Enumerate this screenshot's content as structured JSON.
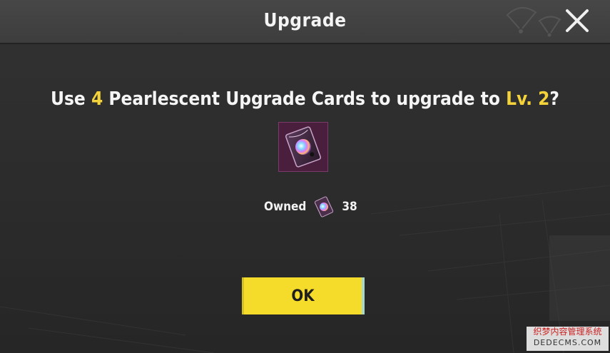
{
  "header": {
    "title": "Upgrade",
    "close_icon": "close-icon"
  },
  "prompt": {
    "prefix": "Use ",
    "count": "4",
    "middle": " Pearlescent Upgrade Cards to upgrade to ",
    "level": "Lv. 2",
    "suffix": "?"
  },
  "item": {
    "icon": "pearlescent-upgrade-card-icon"
  },
  "owned": {
    "label": "Owned",
    "count": "38",
    "icon": "pearlescent-upgrade-card-icon"
  },
  "ok_button": {
    "label": "OK"
  },
  "watermark": {
    "line1": "织梦内容管理系统",
    "line2": "DEDECMS.COM"
  },
  "colors": {
    "accent_yellow": "#f4d23a",
    "button_yellow": "#f6dc2a",
    "background": "#2e2e2e",
    "header": "#424242"
  }
}
